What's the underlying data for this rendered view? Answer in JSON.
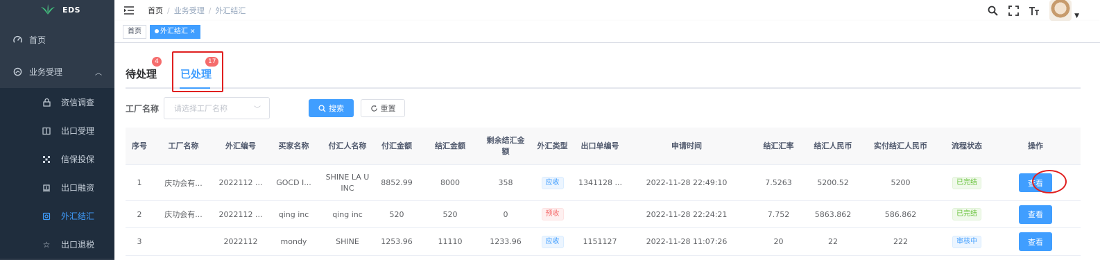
{
  "app": {
    "logo_text": "EDS"
  },
  "sidebar": {
    "items": [
      {
        "label": "首页",
        "icon": "dashboard-icon"
      },
      {
        "label": "业务受理",
        "icon": "business-icon",
        "expanded": true
      }
    ],
    "submenu": [
      {
        "label": "资信调查",
        "icon": "lock-icon"
      },
      {
        "label": "出口受理",
        "icon": "book-icon"
      },
      {
        "label": "信保投保",
        "icon": "grid-icon"
      },
      {
        "label": "出口融资",
        "icon": "finance-icon"
      },
      {
        "label": "外汇结汇",
        "icon": "exchange-icon",
        "active": true
      },
      {
        "label": "出口退税",
        "icon": "star-icon"
      }
    ]
  },
  "breadcrumb": [
    "首页",
    "业务受理",
    "外汇结汇"
  ],
  "tagsview": {
    "home": "首页",
    "active": "外汇结汇"
  },
  "tabs": [
    {
      "label": "待处理",
      "badge": "4"
    },
    {
      "label": "已处理",
      "badge": "17",
      "active": true
    }
  ],
  "filter": {
    "label": "工厂名称",
    "placeholder": "请选择工厂名称",
    "search_label": "搜索",
    "reset_label": "重置"
  },
  "table": {
    "headers": [
      "序号",
      "工厂名称",
      "外汇编号",
      "买家名称",
      "付汇人名称",
      "付汇金额",
      "结汇金额",
      "剩余结汇金额",
      "外汇类型",
      "出口单编号",
      "申请时间",
      "结汇汇率",
      "结汇人民币",
      "实付结汇人民币",
      "流程状态",
      "操作"
    ],
    "rows": [
      {
        "idx": "1",
        "factory": "庆功会有...",
        "fxno": "2022112 ...",
        "buyer": "GOCD I...",
        "payer": "SHINE LA U INC",
        "payamt": "8852.99",
        "settle": "8000",
        "remain": "358",
        "type": "应收",
        "type_color": "blue",
        "export": "1341128 ...",
        "time": "2022-11-28 22:49:10",
        "rate": "7.5263",
        "rmb": "5200.52",
        "actual": "5200",
        "status": "已完结",
        "status_color": "green",
        "op": "查看"
      },
      {
        "idx": "2",
        "factory": "庆功会有...",
        "fxno": "2022112 ...",
        "buyer": "qing inc",
        "payer": "qing inc",
        "payamt": "520",
        "settle": "520",
        "remain": "0",
        "type": "预收",
        "type_color": "red",
        "export": "",
        "time": "2022-11-28 22:24:21",
        "rate": "7.752",
        "rmb": "5863.862",
        "actual": "586.862",
        "status": "已完结",
        "status_color": "green",
        "op": "查看"
      },
      {
        "idx": "3",
        "factory": "",
        "fxno": "2022112",
        "buyer": "mondy",
        "payer": "SHINE",
        "payamt": "1253.96",
        "settle": "11110",
        "remain": "1233.96",
        "type": "应收",
        "type_color": "blue",
        "export": "1151127",
        "time": "2022-11-28 11:07:26",
        "rate": "20",
        "rmb": "22",
        "actual": "222",
        "status": "审核中",
        "status_color": "blue",
        "op": "查看"
      }
    ]
  }
}
